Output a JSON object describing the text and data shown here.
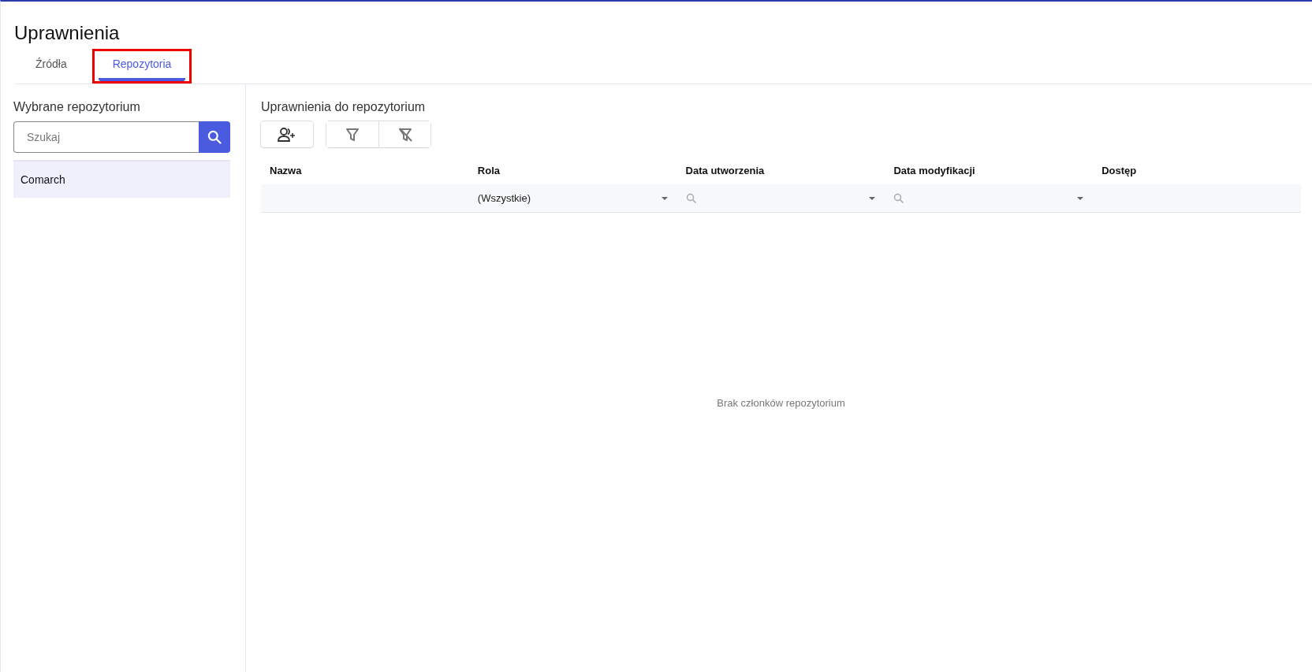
{
  "page": {
    "title": "Uprawnienia"
  },
  "tabs": [
    {
      "label": "Źródła",
      "selected": false,
      "highlighted": false
    },
    {
      "label": "Repozytoria",
      "selected": true,
      "highlighted": true
    }
  ],
  "sidebar": {
    "title": "Wybrane repozytorium",
    "search": {
      "placeholder": "Szukaj"
    },
    "items": [
      {
        "label": "Comarch",
        "selected": true
      }
    ]
  },
  "main": {
    "title": "Uprawnienia do repozytorium",
    "table": {
      "columns": [
        {
          "label": "Nazwa",
          "filter": {
            "kind": "none"
          }
        },
        {
          "label": "Rola",
          "filter": {
            "kind": "select",
            "value": "(Wszystkie)"
          }
        },
        {
          "label": "Data utworzenia",
          "filter": {
            "kind": "date"
          }
        },
        {
          "label": "Data modyfikacji",
          "filter": {
            "kind": "date"
          }
        },
        {
          "label": "Dostęp",
          "filter": {
            "kind": "none"
          }
        }
      ],
      "empty_message": "Brak członków repozytorium"
    }
  }
}
